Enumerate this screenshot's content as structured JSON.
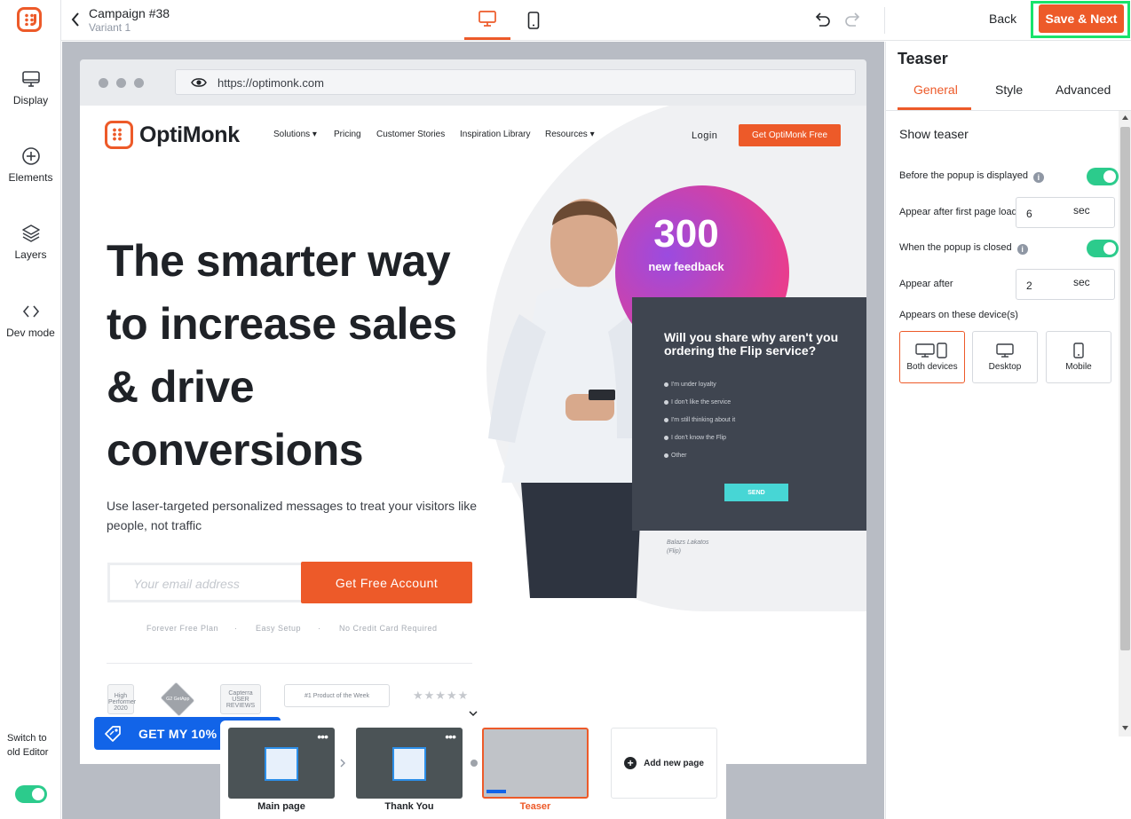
{
  "rail": {
    "items": [
      {
        "label": "Display",
        "icon": "monitor-icon"
      },
      {
        "label": "Elements",
        "icon": "plus-circle-icon"
      },
      {
        "label": "Layers",
        "icon": "layers-icon"
      },
      {
        "label": "Dev mode",
        "icon": "code-icon"
      }
    ],
    "old_editor": "Switch to old Editor",
    "old_editor_on": true
  },
  "header": {
    "title": "Campaign #38",
    "subtitle": "Variant 1",
    "device_active": "desktop",
    "back_label": "Back",
    "save_label": "Save & Next"
  },
  "browser": {
    "url": "https://optimonk.com"
  },
  "site": {
    "brand": "OptiMonk",
    "nav": [
      "Solutions",
      "Pricing",
      "Customer Stories",
      "Inspiration Library",
      "Resources"
    ],
    "login": "Login",
    "cta": "Get OptiMonk Free",
    "headline": "The smarter way to increase sales & drive conversions",
    "subtext": "Use laser-targeted personalized messages to treat your visitors like people, not traffic",
    "email_placeholder": "Your email address",
    "signup_button": "Get Free Account",
    "features": [
      "Forever Free Plan",
      "·",
      "Easy Setup",
      "·",
      "No Credit Card Required"
    ],
    "badges": [
      "High Performer 2020",
      "G2 GetApp",
      "Capterra USER REVIEWS",
      "#1 Product of the Week"
    ],
    "stat_number": "300",
    "stat_label": "new feedback",
    "survey_question": "Will you share why aren't you ordering the Flip service?",
    "survey_options": [
      "I'm under loyalty",
      "I don't like the service",
      "I'm still thinking about it",
      "I don't know the Flip",
      "Other"
    ],
    "survey_send": "SEND",
    "signature_name": "Balazs Lakatos",
    "signature_company": "(Flip)",
    "accent": "#ed5a29"
  },
  "teaser": {
    "label": "GET MY 10%"
  },
  "pages": [
    {
      "label": "Main page",
      "selected": false
    },
    {
      "label": "Thank You",
      "selected": false
    },
    {
      "label": "Teaser",
      "selected": true
    }
  ],
  "add_page_label": "Add new page",
  "panel": {
    "title": "Teaser",
    "tabs": [
      "General",
      "Style",
      "Advanced"
    ],
    "active_tab": "General",
    "section_title": "Show teaser",
    "before_popup_label": "Before the popup is displayed",
    "before_popup_on": true,
    "appear_after_load_label": "Appear after first page load",
    "appear_after_load_value": "6",
    "appear_after_load_unit": "sec",
    "when_closed_label": "When the popup is closed",
    "when_closed_on": true,
    "appear_after_label": "Appear after",
    "appear_after_value": "2",
    "appear_after_unit": "sec",
    "devices_label": "Appears on these device(s)",
    "devices": [
      "Both devices",
      "Desktop",
      "Mobile"
    ],
    "devices_selected": "Both devices"
  }
}
